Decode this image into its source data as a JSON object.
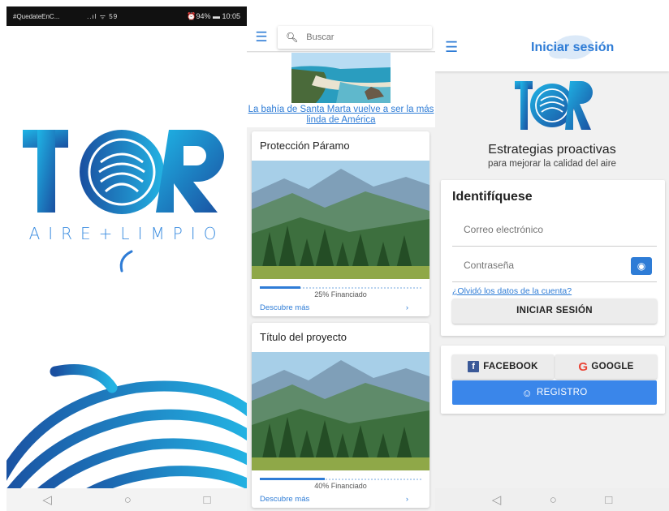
{
  "splash": {
    "status_left": "#QuedateEnC...",
    "status_signal": "..ıl ᯤ 59",
    "status_right": "⏰94% ▬ 10:05",
    "tagline": "AIRE+LIMPIO",
    "nav_back": "◁",
    "nav_home": "○",
    "nav_recent": "□"
  },
  "feed": {
    "menu_icon": "menu-icon",
    "search_placeholder": "Buscar",
    "news_title": "La bahía de Santa Marta vuelve a ser la más linda de América",
    "projects": [
      {
        "title": "Protección Páramo",
        "funded_text": "25% Financiado",
        "funded_fraction": 0.25,
        "more_label": "Descubre más"
      },
      {
        "title": "Título del proyecto",
        "funded_text": "40% Financiado",
        "funded_fraction": 0.4,
        "more_label": "Descubre más"
      }
    ]
  },
  "login": {
    "header_title": "Iniciar sesión",
    "heading": "Estrategias proactivas",
    "subheading": "para mejorar la calidad del aire",
    "form_title": "Identifíquese",
    "email_placeholder": "Correo electrónico",
    "password_placeholder": "Contraseña",
    "forgot_link": "¿Olvidó los datos de la cuenta?",
    "login_button": "INICIAR SESIÓN",
    "facebook_button": "FACEBOOK",
    "google_button": "GOOGLE",
    "register_button": "REGISTRO",
    "nav_back": "◁",
    "nav_home": "○",
    "nav_recent": "□"
  },
  "colors": {
    "accent": "#2e7cd6",
    "register_bg": "#3a86ea",
    "facebook": "#3b5998",
    "google": "#ea4335"
  }
}
